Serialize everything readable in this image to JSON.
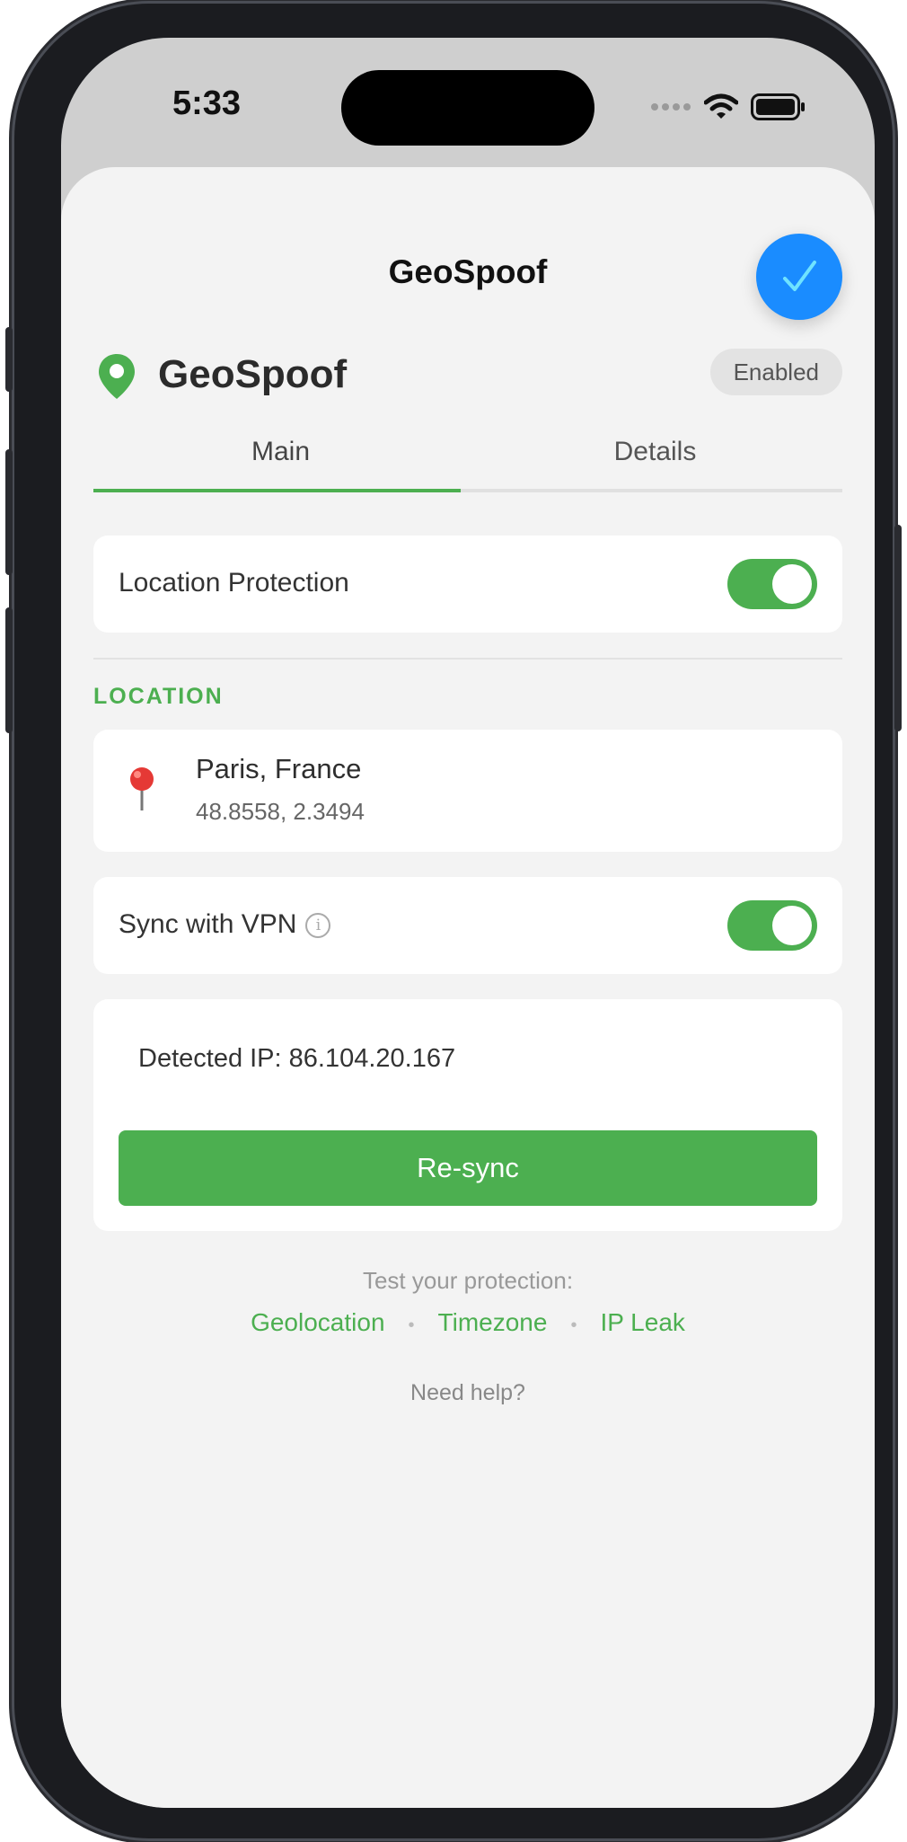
{
  "status_bar": {
    "time": "5:33"
  },
  "sheet": {
    "title": "GeoSpoof"
  },
  "header": {
    "app_name": "GeoSpoof",
    "status_badge": "Enabled"
  },
  "tabs": [
    {
      "label": "Main",
      "active": true
    },
    {
      "label": "Details",
      "active": false
    }
  ],
  "protection": {
    "label": "Location Protection",
    "enabled": true
  },
  "location": {
    "section_label": "LOCATION",
    "name": "Paris, France",
    "coordinates": "48.8558, 2.3494"
  },
  "vpn_sync": {
    "label": "Sync with VPN",
    "enabled": true
  },
  "ip": {
    "detected_text": "Detected IP: 86.104.20.167",
    "resync_label": "Re-sync"
  },
  "footer": {
    "test_label": "Test your protection:",
    "links": [
      "Geolocation",
      "Timezone",
      "IP Leak"
    ],
    "help_label": "Need help?"
  },
  "colors": {
    "accent": "#4caf50",
    "done_button": "#1a8cff",
    "background": "#f3f3f3"
  },
  "icons": [
    "checkmark-icon",
    "map-pin-icon",
    "red-pushpin-icon",
    "info-icon",
    "wifi-icon",
    "battery-icon",
    "cellular-signal-icon"
  ]
}
